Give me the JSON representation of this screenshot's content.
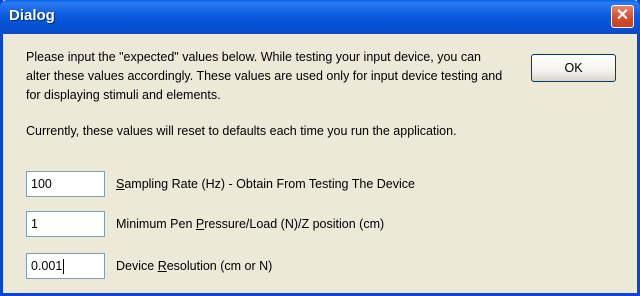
{
  "window": {
    "title": "Dialog",
    "close_glyph": "✕"
  },
  "instructions": {
    "line1": "Please input the \"expected\" values below. While testing your input device, you can alter these values accordingly. These values are used only for input device testing and for displaying stimuli and elements.",
    "line2": "Currently, these values will reset to defaults each time you run the application."
  },
  "buttons": {
    "ok_label": "OK"
  },
  "fields": [
    {
      "value": "100",
      "label_mnemonic": "S",
      "label_rest": "ampling Rate (Hz) - Obtain From Testing The Device"
    },
    {
      "value": "1",
      "label_pre": "Minimum Pen ",
      "label_mnemonic": "P",
      "label_rest": "ressure/Load (N)/Z position (cm)"
    },
    {
      "value": "0.001",
      "label_pre": "Device ",
      "label_mnemonic": "R",
      "label_rest": "esolution (cm or N)"
    }
  ],
  "colors": {
    "titlebar": "#0453d4",
    "dialog_bg": "#ece9d8",
    "close_button": "#d8512f"
  }
}
